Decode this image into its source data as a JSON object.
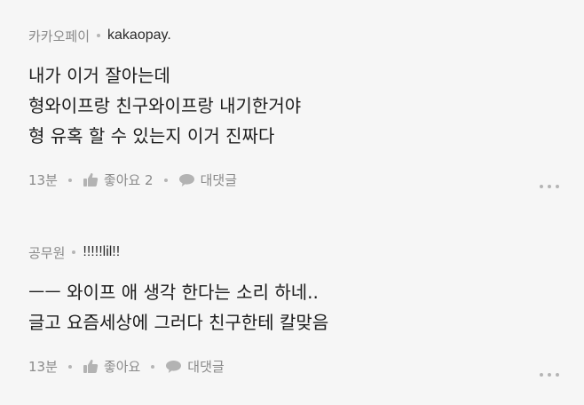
{
  "comments": [
    {
      "author": "카카오페이",
      "nickname": "kakaopay.",
      "text": "내가 이거 잘아는데\n형와이프랑 친구와이프랑 내기한거야\n형 유혹 할 수 있는지 이거 진짜다",
      "time": "13분",
      "like_label": "좋아요 2",
      "reply_label": "대댓글"
    },
    {
      "author": "공무원",
      "nickname": "!!!!!lil!!",
      "text": "ㅡㅡ 와이프 애 생각 한다는 소리 하네..\n글고 요즘세상에 그러다 친구한테 칼맞음",
      "time": "13분",
      "like_label": "좋아요",
      "reply_label": "대댓글"
    }
  ],
  "icons": {
    "like": "thumbs-up-icon",
    "reply": "speech-bubble-icon",
    "more": "more-dots-icon"
  },
  "colors": {
    "background": "#f6f6f6",
    "meta_text": "#8a8a8a",
    "body_text": "#1c1c1c"
  }
}
